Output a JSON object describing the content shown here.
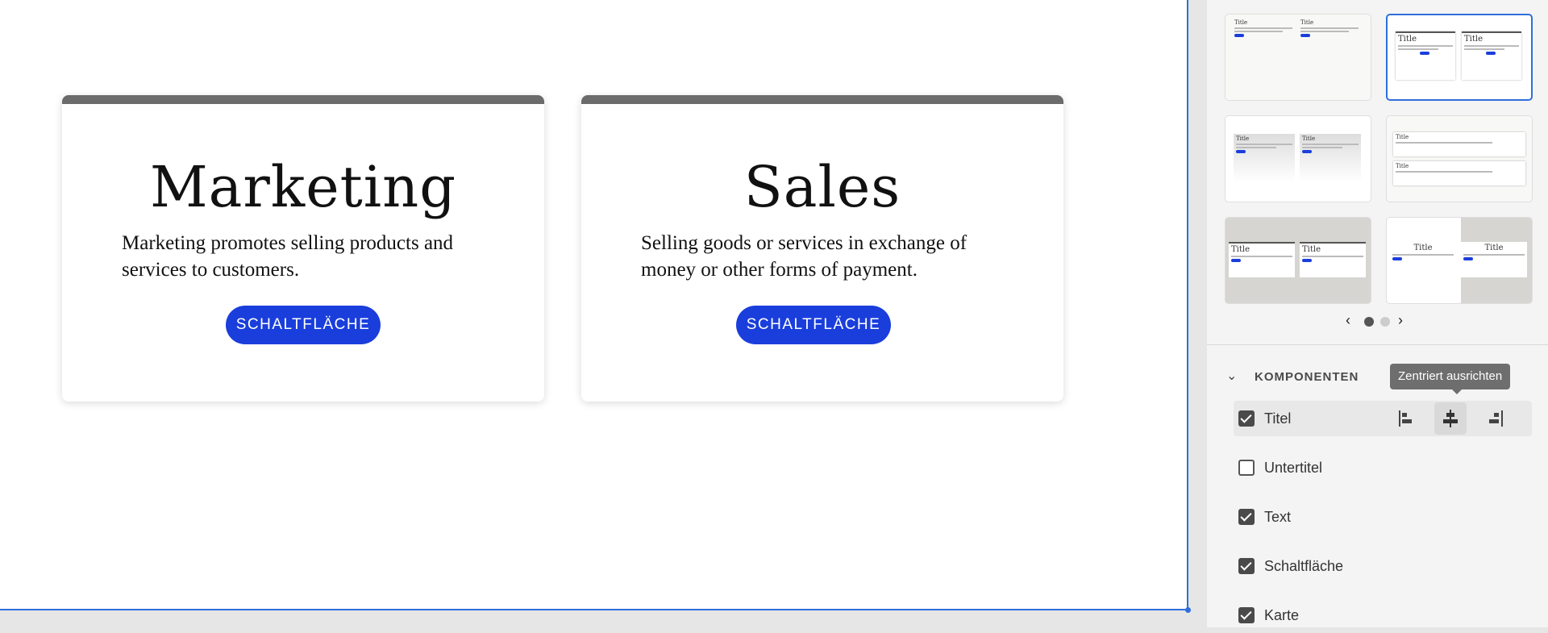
{
  "canvas": {
    "cards": [
      {
        "title": "Marketing",
        "text": "Marketing promotes selling products and services to customers.",
        "button_label": "SCHALTFLÄCHE"
      },
      {
        "title": "Sales",
        "text": "Selling goods or services in exchange of money or other forms of payment.",
        "button_label": "SCHALTFLÄCHE"
      }
    ]
  },
  "panel": {
    "thumbnail_title": "Title",
    "pager": {
      "prev_icon": "chevron-left-icon",
      "next_icon": "chevron-right-icon",
      "page_count": 2,
      "current_page": 1
    },
    "components_section": {
      "label": "KOMPONENTEN",
      "tooltip": "Zentriert ausrichten",
      "items": [
        {
          "label": "Titel",
          "checked": true
        },
        {
          "label": "Untertitel",
          "checked": false
        },
        {
          "label": "Text",
          "checked": true
        },
        {
          "label": "Schaltfläche",
          "checked": true
        },
        {
          "label": "Karte",
          "checked": true
        }
      ]
    }
  },
  "colors": {
    "accent": "#1a3edc",
    "selection": "#2f6fdc",
    "card_bar": "#6b6b6b"
  }
}
